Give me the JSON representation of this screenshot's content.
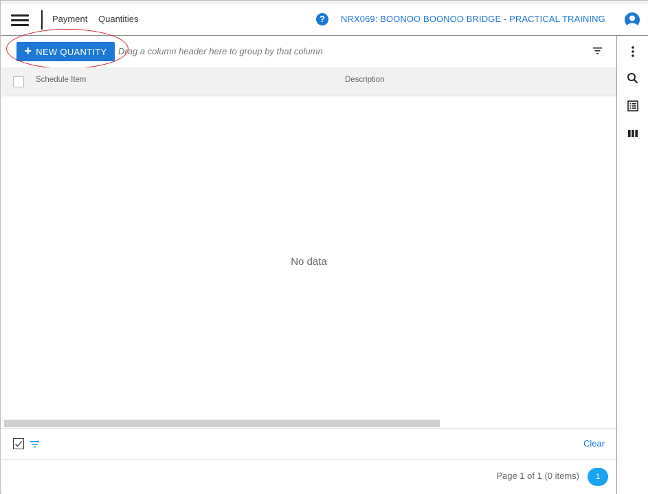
{
  "header": {
    "breadcrumb": [
      "Payment",
      "Quantities"
    ],
    "project_title": "NRX069: BOONOO BOONOO BRIDGE - PRACTICAL TRAINING",
    "help_glyph": "?",
    "icons": [
      "menu-icon",
      "help-icon",
      "account-icon"
    ]
  },
  "toolbar": {
    "new_button_label": "NEW QUANTITY",
    "new_button_icon": "+",
    "group_hint": "Drag a column header here to group by that column"
  },
  "grid": {
    "columns": [
      "Schedule Item",
      "Description"
    ],
    "rows": [],
    "empty_text": "No data"
  },
  "filter_row": {
    "clear_label": "Clear"
  },
  "pager": {
    "info": "Page 1 of 1 (0 items)",
    "current_page": "1"
  },
  "right_rail": {
    "icons": [
      "more-vert-icon",
      "search-icon",
      "list-icon",
      "columns-icon"
    ]
  },
  "colors": {
    "accent": "#1e78d6",
    "pager_active": "#1aa3f0",
    "annotation": "#d2232a"
  }
}
